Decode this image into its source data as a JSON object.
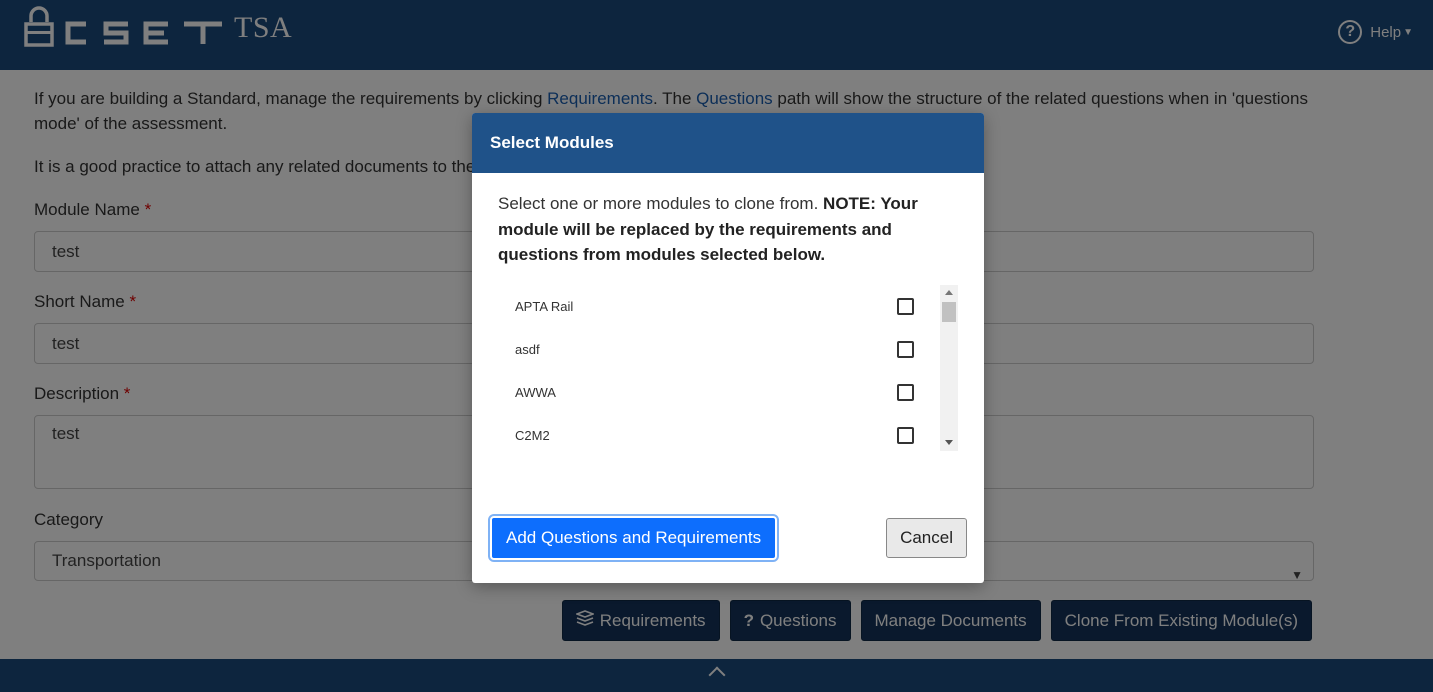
{
  "header": {
    "brand": "CSET",
    "brand_suffix": "TSA",
    "help_label": "Help"
  },
  "page": {
    "intro_line1_pre": "If you are building a Standard, manage the requirements by clicking ",
    "intro_link1": "Requirements",
    "intro_line1_mid": ". The ",
    "intro_link2": "Questions",
    "intro_line1_post": " path will show the structure of the related questions when in 'questions mode' of the assessment.",
    "intro_line2": "It is a good practice to attach any related documents to the",
    "module_name_label": "Module Name",
    "module_name_value": "test",
    "short_name_label": "Short Name",
    "short_name_value": "test",
    "description_label": "Description",
    "description_value": "test",
    "category_label": "Category",
    "category_value": "Transportation",
    "required_mark": "*"
  },
  "actions": {
    "requirements": "Requirements",
    "questions": "Questions",
    "questions_icon": "?",
    "manage_documents": "Manage Documents",
    "clone": "Clone From Existing Module(s)"
  },
  "modal": {
    "title": "Select Modules",
    "message_plain": "Select one or more modules to clone from. ",
    "message_bold": "NOTE: Your module will be replaced by the requirements and questions from modules selected below.",
    "modules": [
      {
        "label": "APTA Rail",
        "checked": false
      },
      {
        "label": "asdf",
        "checked": false
      },
      {
        "label": "AWWA",
        "checked": false
      },
      {
        "label": "C2M2",
        "checked": false
      }
    ],
    "primary_button": "Add Questions and Requirements",
    "cancel_button": "Cancel"
  }
}
